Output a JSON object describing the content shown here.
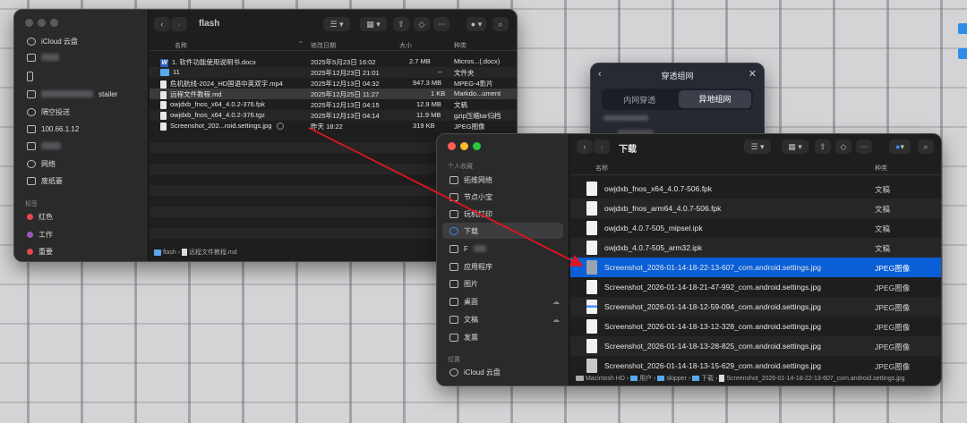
{
  "win1": {
    "title": "flash",
    "sidebar": {
      "icloud": "iCloud 云盘",
      "device_suffix": "stailer",
      "airdrop": "隔空投送",
      "ip": "100.66.1.12",
      "network": "网络",
      "trash": "废纸篓",
      "tags_head": "标签",
      "tags": [
        {
          "label": "红色",
          "color": "#e5484d"
        },
        {
          "label": "工作",
          "color": "#9b59b6"
        },
        {
          "label": "重要",
          "color": "#e5484d"
        }
      ]
    },
    "columns": {
      "name": "名称",
      "date": "修改日期",
      "size": "大小",
      "kind": "种类"
    },
    "rows": [
      {
        "name": "1. 软件功能使用说明书.docx",
        "date": "2025年5月23日 16:02",
        "size": "2.7 MB",
        "kind": "Micros...(.docx)",
        "icon": "word"
      },
      {
        "name": "11",
        "date": "2025年12月23日 21:01",
        "size": "--",
        "kind": "文件夹",
        "icon": "folder"
      },
      {
        "name": "危机航线-2024_HD国语中英双字.mp4",
        "date": "2025年12月13日 04:32",
        "size": "947.3 MB",
        "kind": "MPEG-4影片",
        "icon": "doc"
      },
      {
        "name": "远程文件教程.md",
        "date": "2025年12月25日 11:27",
        "size": "1 KB",
        "kind": "Markdo...ument",
        "icon": "doc"
      },
      {
        "name": "owjdxb_fnos_x64_4.0.2-376.fpk",
        "date": "2025年12月13日 04:15",
        "size": "12.9 MB",
        "kind": "文稿",
        "icon": "doc"
      },
      {
        "name": "owjdxb_fnos_x64_4.0.2-376.tgz",
        "date": "2025年12月13日 04:14",
        "size": "11.9 MB",
        "kind": "gzip压缩tar归档",
        "icon": "doc"
      },
      {
        "name": "Screenshot_202...roid.settings.jpg",
        "date": "昨天 18:22",
        "size": "319 KB",
        "kind": "JPEG图像",
        "icon": "doc"
      }
    ],
    "path": [
      "flash",
      "远程文件教程.md"
    ]
  },
  "popup": {
    "title": "穿透组网",
    "tab1": "内网穿透",
    "tab2": "异地组网"
  },
  "win2": {
    "title": "下载",
    "sidebar": {
      "fav_head": "个人收藏",
      "items": [
        "拓维网络",
        "节点小宝",
        "玩机打印",
        "下载",
        "F",
        "应用程序",
        "图片",
        "桌面",
        "文稿",
        "发票"
      ],
      "loc_head": "位置",
      "icloud": "iCloud 云盘"
    },
    "columns": {
      "name": "名称",
      "kind": "种类"
    },
    "rows": [
      {
        "name": "owjdxb_fnos_x64_4.0.7-506.fpk",
        "kind": "文稿"
      },
      {
        "name": "owjdxb_fnos_arm64_4.0.7-506.fpk",
        "kind": "文稿"
      },
      {
        "name": "owjdxb_4.0.7-505_mipsel.ipk",
        "kind": "文稿"
      },
      {
        "name": "owjdxb_4.0.7-505_arm32.ipk",
        "kind": "文稿"
      },
      {
        "name": "Screenshot_2026-01-14-18-22-13-607_com.android.settings.jpg",
        "kind": "JPEG图像"
      },
      {
        "name": "Screenshot_2026-01-14-18-21-47-992_com.android.settings.jpg",
        "kind": "JPEG图像"
      },
      {
        "name": "Screenshot_2026-01-14-18-12-59-094_com.android.settings.jpg",
        "kind": "JPEG图像"
      },
      {
        "name": "Screenshot_2026-01-14-18-13-12-328_com.android.settings.jpg",
        "kind": "JPEG图像"
      },
      {
        "name": "Screenshot_2026-01-14-18-13-28-825_com.android.settings.jpg",
        "kind": "JPEG图像"
      },
      {
        "name": "Screenshot_2026-01-14-18-13-15-629_com.android.settings.jpg",
        "kind": "JPEG图像"
      }
    ],
    "path": [
      "Macintosh HD",
      "用户",
      "skipper",
      "下载",
      "Screenshot_2026-01-14-18-22-13-607_com.android.settings.jpg"
    ]
  },
  "colors": {
    "accent": "#0a5fd6",
    "arrow": "#e0141e"
  }
}
